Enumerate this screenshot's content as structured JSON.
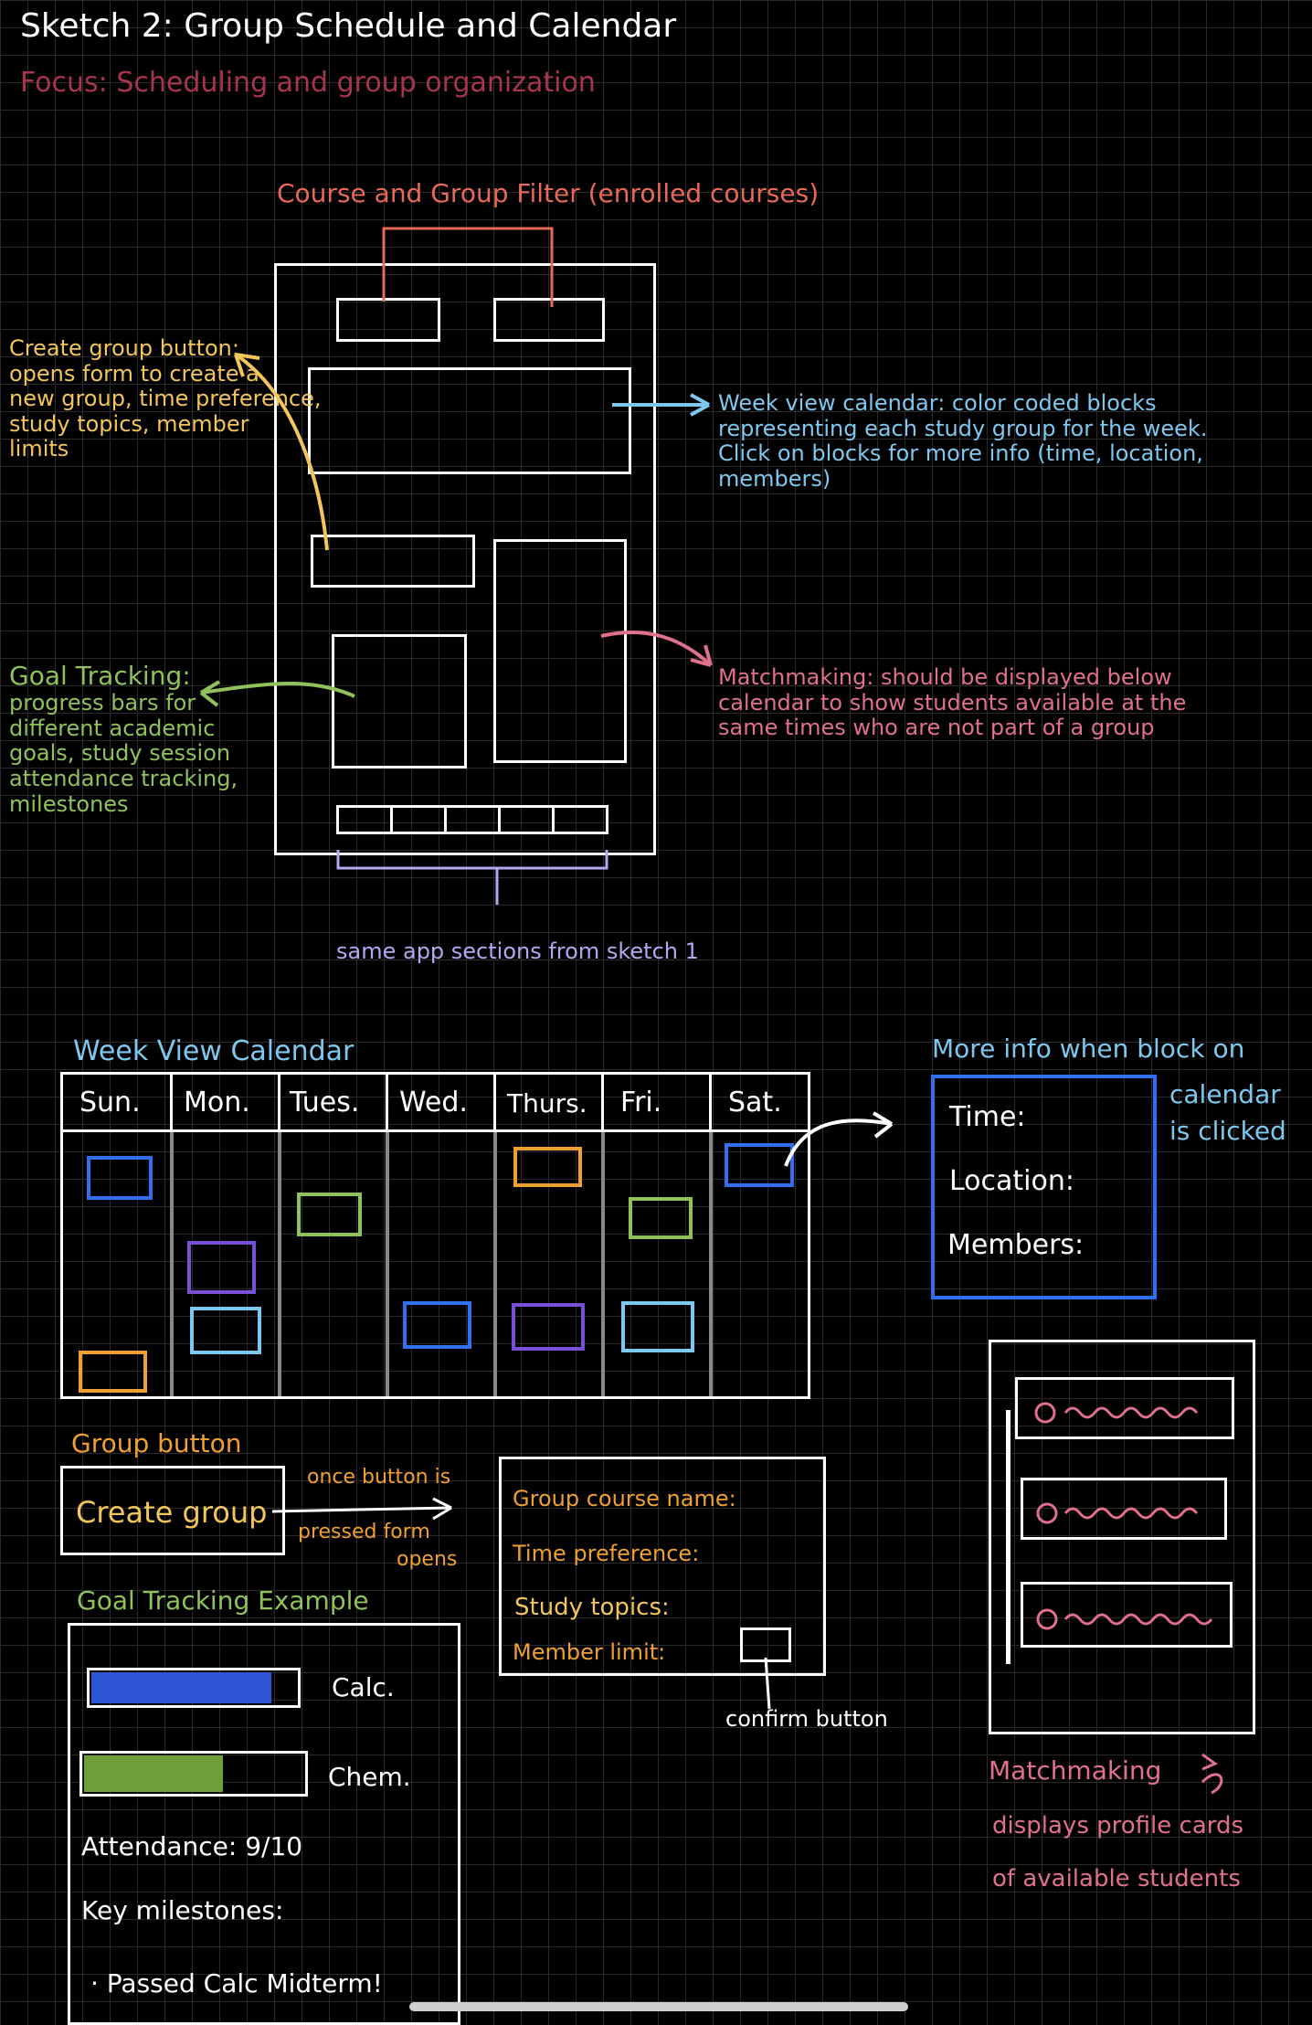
{
  "header": {
    "title": "Sketch 2: Group Schedule and Calendar",
    "focus": "Focus: Scheduling and group organization"
  },
  "overview": {
    "filter_label": "Course and Group Filter (enrolled courses)",
    "create_group": {
      "lines": [
        "Create group button:",
        "opens form to create a",
        "new group, time preference,",
        "study topics, member",
        "limits"
      ]
    },
    "week_view": {
      "lines": [
        "Week view calendar: color coded blocks",
        "representing each study group for the week.",
        "Click on blocks for more info (time, location,",
        "members)"
      ]
    },
    "goal_tracking": {
      "lines": [
        "Goal Tracking:",
        "progress bars for",
        "different academic",
        "goals, study session",
        "attendance tracking,",
        "milestones"
      ]
    },
    "matchmaking": {
      "lines": [
        "Matchmaking: should be displayed below",
        "calendar to show students available at the",
        "same times who are not part of a group"
      ]
    },
    "app_sections": "same app sections from sketch 1"
  },
  "calendar": {
    "title": "Week View Calendar",
    "days": [
      "Sun.",
      "Mon.",
      "Tues.",
      "Wed.",
      "Thurs.",
      "Fri.",
      "Sat."
    ]
  },
  "more_info": {
    "title_lines": [
      "More info when block on",
      "calendar",
      "is clicked"
    ],
    "fields": [
      "Time:",
      "Location:",
      "Members:"
    ]
  },
  "group_button": {
    "title": "Group button",
    "label": "Create group",
    "note_lines": [
      "once button is",
      "pressed form",
      "opens"
    ]
  },
  "form": {
    "fields": [
      "Group course name:",
      "Time preference:",
      "Study topics:",
      "Member limit:"
    ],
    "confirm_label": "confirm button"
  },
  "goal_example": {
    "title": "Goal Tracking Example",
    "bars": [
      {
        "label": "Calc.",
        "progress": 0.88,
        "color": "#2d55d6"
      },
      {
        "label": "Chem.",
        "progress": 0.64,
        "color": "#6d9e3a"
      }
    ],
    "attendance": "Attendance: 9/10",
    "milestones_title": "Key milestones:",
    "milestones": [
      "· Passed Calc Midterm!"
    ]
  },
  "matchmaking_example": {
    "title": "Matchmaking",
    "desc_lines": [
      "displays profile cards",
      "of available students"
    ]
  },
  "colors": {
    "white": "#ffffff",
    "red": "#e8685a",
    "maroon": "#a8344f",
    "yellow": "#f3c55a",
    "light_blue": "#7ec8f0",
    "pink": "#e0708e",
    "green": "#8fc25a",
    "lavender": "#b7a6f2",
    "blue": "#2f6ff0",
    "purple": "#7a4fd8",
    "orange": "#f0a030"
  }
}
